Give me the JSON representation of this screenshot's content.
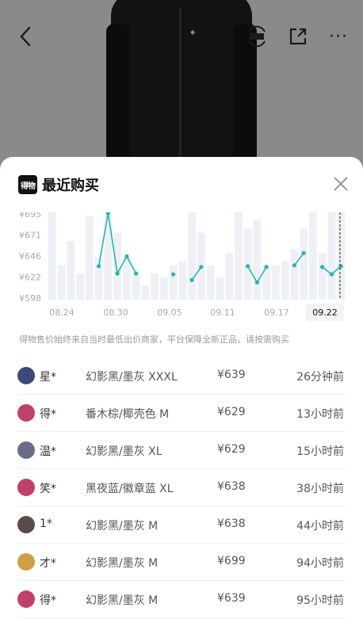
{
  "header": {
    "title": "最近购买",
    "brand_logo_text": "得物"
  },
  "chart_data": {
    "type": "line",
    "y_axis_labels": [
      "¥695",
      "¥671",
      "¥646",
      "¥622",
      "¥598"
    ],
    "ylim": [
      598,
      705
    ],
    "x_axis_labels": [
      "08.24",
      "08.30",
      "09.05",
      "09.11",
      "09.17",
      "09.22"
    ],
    "highlighted_x_label": "09.22",
    "series": [
      {
        "values": [
          null,
          null,
          null,
          null,
          null,
          639,
          704,
          630,
          651,
          630,
          null,
          null,
          null,
          629,
          null,
          622,
          638,
          null,
          null,
          null,
          null,
          639,
          619,
          638,
          null,
          null,
          640,
          655,
          null,
          638,
          629,
          639
        ]
      }
    ],
    "bar_values": [
      705,
      640,
      670,
      630,
      700,
      650,
      705,
      680,
      650,
      630,
      615,
      630,
      625,
      640,
      645,
      705,
      680,
      640,
      625,
      655,
      705,
      685,
      695,
      640,
      640,
      645,
      660,
      685,
      705,
      655,
      705,
      705
    ],
    "grid": true
  },
  "notice": "得物售价始终来自当时最低出价商家，平台保障全新正品，请按需购买",
  "purchases": [
    {
      "user": "星*",
      "sku": "幻影黑/墨灰 XXXL",
      "price": "¥639",
      "time": "26分钟前",
      "avatar_color": "#3b4a7a"
    },
    {
      "user": "得*",
      "sku": "番木棕/椰壳色 M",
      "price": "¥629",
      "time": "13小时前",
      "avatar_color": "#c0406a"
    },
    {
      "user": "温*",
      "sku": "幻影黑/墨灰 XL",
      "price": "¥629",
      "time": "15小时前",
      "avatar_color": "#6a6a8a"
    },
    {
      "user": "笑*",
      "sku": "黑夜蓝/徽章蓝 XL",
      "price": "¥638",
      "time": "38小时前",
      "avatar_color": "#c0406a"
    },
    {
      "user": "1*",
      "sku": "幻影黑/墨灰 M",
      "price": "¥638",
      "time": "44小时前",
      "avatar_color": "#5a4a4a"
    },
    {
      "user": "才*",
      "sku": "幻影黑/墨灰 M",
      "price": "¥699",
      "time": "94小时前",
      "avatar_color": "#d0a040"
    },
    {
      "user": "得*",
      "sku": "幻影黑/墨灰 M",
      "price": "¥639",
      "time": "95小时前",
      "avatar_color": "#c0406a"
    }
  ],
  "colors": {
    "line": "#20b8b0",
    "bar": "#eef0f6",
    "overlay": "#8a8a8a"
  }
}
